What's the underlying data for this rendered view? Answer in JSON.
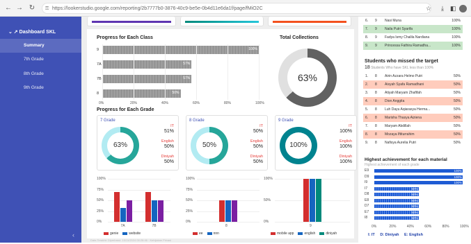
{
  "browser": {
    "url": "https://lookerstudio.google.com/reporting/2b7777b0-3876-40c9-be5e-0b4d11e6da1f/page/fMiO2C"
  },
  "sidebar": {
    "title": "Dashboard SKL",
    "items": [
      {
        "label": "Summary",
        "active": true
      },
      {
        "label": "7th Grade",
        "active": false
      },
      {
        "label": "8th Grade",
        "active": false
      },
      {
        "label": "9th Grade",
        "active": false
      }
    ]
  },
  "progress_class": {
    "title": "Progress for Each Class",
    "x_ticks": [
      "0%",
      "20%",
      "40%",
      "60%",
      "80%",
      "100%"
    ]
  },
  "total_collections": {
    "title": "Total Collections",
    "value": "63%"
  },
  "grade_title": "Progress for Each Grade",
  "grade_cards": [
    {
      "title": "7 Grade",
      "total": "63%",
      "it_label": "IT",
      "it": "51%",
      "en_label": "English",
      "en": "50%",
      "di_label": "Diniyah",
      "di": "50%"
    },
    {
      "title": "8 Grade",
      "total": "50%",
      "it_label": "IT",
      "it": "50%",
      "en_label": "English",
      "en": "50%",
      "di_label": "Diniyah",
      "di": "50%"
    },
    {
      "title": "9 Grade",
      "total": "100%",
      "it_label": "IT",
      "it": "100%",
      "en_label": "English",
      "en": "100%",
      "di_label": "Diniyah",
      "di": "100%"
    }
  ],
  "chart_data": [
    {
      "type": "bar",
      "orientation": "horizontal",
      "title": "Progress for Each Class",
      "categories": [
        "9",
        "7A",
        "7B",
        "8"
      ],
      "values": [
        100,
        57,
        57,
        50
      ],
      "xlim": [
        0,
        100
      ]
    },
    {
      "type": "pie",
      "title": "Total Collections",
      "values": [
        63,
        37
      ]
    },
    {
      "type": "bar",
      "categories": [
        "7A",
        "7B"
      ],
      "y_ticks": [
        "0%",
        "25%",
        "50%",
        "75%",
        "100%"
      ],
      "series": [
        {
          "name": "genie",
          "color": "#d32f2f",
          "values": [
            70,
            70
          ]
        },
        {
          "name": "website",
          "color": "#1565c0",
          "values": [
            33,
            50
          ]
        },
        {
          "name": "",
          "color": "#7b1fa2",
          "values": [
            50,
            50
          ]
        }
      ]
    },
    {
      "type": "bar",
      "categories": [
        "8"
      ],
      "y_ticks": [
        "0%",
        "25%",
        "50%",
        "75%",
        "100%"
      ],
      "series": [
        {
          "name": "ee",
          "color": "#d32f2f",
          "values": [
            50
          ]
        },
        {
          "name": "nnn",
          "color": "#1565c0",
          "values": [
            50
          ]
        },
        {
          "name": "",
          "color": "#7b1fa2",
          "values": [
            50
          ]
        }
      ]
    },
    {
      "type": "bar",
      "categories": [
        "9"
      ],
      "y_ticks": [
        "0%",
        "50%",
        "100%"
      ],
      "series": [
        {
          "name": "mobile app",
          "color": "#d32f2f",
          "values": [
            100
          ]
        },
        {
          "name": "english",
          "color": "#1565c0",
          "values": [
            100
          ]
        },
        {
          "name": "diniyah",
          "color": "#00897b",
          "values": [
            100
          ]
        }
      ]
    },
    {
      "type": "bar",
      "orientation": "horizontal",
      "title": "Highest achievement for each material",
      "subtitle": "Highest achievement of each grade",
      "categories": [
        "E9",
        "D9",
        "I9",
        "I7",
        "D8",
        "E8",
        "D7",
        "E7",
        "I8"
      ],
      "values": [
        100,
        100,
        100,
        50,
        50,
        50,
        50,
        50,
        50
      ],
      "x_ticks": [
        "0%",
        "20%",
        "40%",
        "60%",
        "80%",
        "100%"
      ]
    }
  ],
  "mini_charts": [
    {
      "legend": [
        {
          "name": "genie",
          "color": "#d32f2f"
        },
        {
          "name": "website",
          "color": "#1565c0"
        }
      ]
    },
    {
      "legend": [
        {
          "name": "ee",
          "color": "#d32f2f"
        },
        {
          "name": "nnn",
          "color": "#1565c0"
        }
      ]
    },
    {
      "legend": [
        {
          "name": "mobile app",
          "color": "#d32f2f"
        },
        {
          "name": "english",
          "color": "#1565c0"
        },
        {
          "name": "diniyah",
          "color": "#00897b"
        }
      ]
    }
  ],
  "top_table": {
    "rows": [
      {
        "no": "6.",
        "grade": "9",
        "name": "Nasi Muna",
        "pct": "100%"
      },
      {
        "no": "7.",
        "grade": "9",
        "name": "Naila Putri Syarifa",
        "pct": "100%"
      },
      {
        "no": "8.",
        "grade": "9",
        "name": "Fadya Ismy Chalila Nardiana",
        "pct": "100%"
      },
      {
        "no": "9.",
        "grade": "9",
        "name": "Princessa Fathira Ramadha...",
        "pct": "100%"
      }
    ]
  },
  "missed": {
    "title": "Students who missed the target",
    "count": "18",
    "subtitle": "Students Who have SKL less than 100%",
    "rows": [
      {
        "no": "1.",
        "grade": "8",
        "name": "Airin Azzara Helmo Putri",
        "pct": "50%"
      },
      {
        "no": "2.",
        "grade": "8",
        "name": "Aisyah Syafa Ramadhani",
        "pct": "50%"
      },
      {
        "no": "3.",
        "grade": "8",
        "name": "Atiyah Maryam Zhafifah",
        "pct": "50%"
      },
      {
        "no": "4.",
        "grade": "8",
        "name": "Dion Anggita",
        "pct": "50%"
      },
      {
        "no": "5.",
        "grade": "8",
        "name": "Luh Dayu Aqiarasya Herma...",
        "pct": "50%"
      },
      {
        "no": "6.",
        "grade": "8",
        "name": "Marisha Thasya Aiziena",
        "pct": "50%"
      },
      {
        "no": "7.",
        "grade": "8",
        "name": "Maryam Abdillah",
        "pct": "50%"
      },
      {
        "no": "8.",
        "grade": "8",
        "name": "Mozaya Iftiturrahim",
        "pct": "50%"
      },
      {
        "no": "9.",
        "grade": "8",
        "name": "Nafisya Aurelia Putri",
        "pct": "50%"
      }
    ]
  },
  "achievement": {
    "title": "Highest achievement for each material",
    "subtitle": "Highest achievement of each grade",
    "legend": [
      "I: IT",
      "D: Diniyah",
      "E: English"
    ]
  },
  "footer": "Data Terakhir Diperbarui: 10/11/2024 09:28:46 · Kebijakan Privasi"
}
